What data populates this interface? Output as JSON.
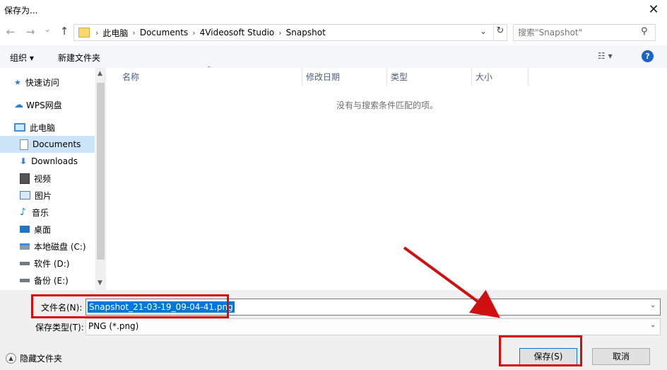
{
  "window": {
    "title": "保存为..."
  },
  "nav": {
    "back": "←",
    "forward": "→",
    "recent": "⌄",
    "up": "↑",
    "dropdown": "⌄",
    "refresh": "↻"
  },
  "address": {
    "crumbs": [
      "此电脑",
      "Documents",
      "4Videosoft Studio",
      "Snapshot"
    ]
  },
  "search": {
    "placeholder": "搜索\"Snapshot\""
  },
  "toolbar": {
    "organize": "组织 ▾",
    "new_folder": "新建文件夹"
  },
  "sidebar": {
    "items": [
      {
        "label": "快速访问",
        "icon": "star-icon"
      },
      {
        "label": "WPS网盘",
        "icon": "cloud-icon"
      },
      {
        "label": "此电脑",
        "icon": "computer-icon"
      },
      {
        "label": "Documents",
        "icon": "document-icon"
      },
      {
        "label": "Downloads",
        "icon": "download-icon"
      },
      {
        "label": "视频",
        "icon": "video-icon"
      },
      {
        "label": "图片",
        "icon": "picture-icon"
      },
      {
        "label": "音乐",
        "icon": "music-icon"
      },
      {
        "label": "桌面",
        "icon": "desktop-icon"
      },
      {
        "label": "本地磁盘 (C:)",
        "icon": "drive-icon"
      },
      {
        "label": "软件 (D:)",
        "icon": "drive-icon"
      },
      {
        "label": "备份 (E:)",
        "icon": "drive-icon"
      }
    ]
  },
  "columns": [
    "名称",
    "修改日期",
    "类型",
    "大小"
  ],
  "empty_message": "没有与搜索条件匹配的项。",
  "form": {
    "filename_label": "文件名(N):",
    "filename_value": "Snapshot_21-03-19_09-04-41.png",
    "filetype_label": "保存类型(T):",
    "filetype_value": "PNG (*.png)"
  },
  "footer": {
    "hide_folders": "隐藏文件夹",
    "save": "保存(S)",
    "cancel": "取消"
  },
  "colors": {
    "accent": "#0078d7",
    "annotation": "#d01010"
  }
}
